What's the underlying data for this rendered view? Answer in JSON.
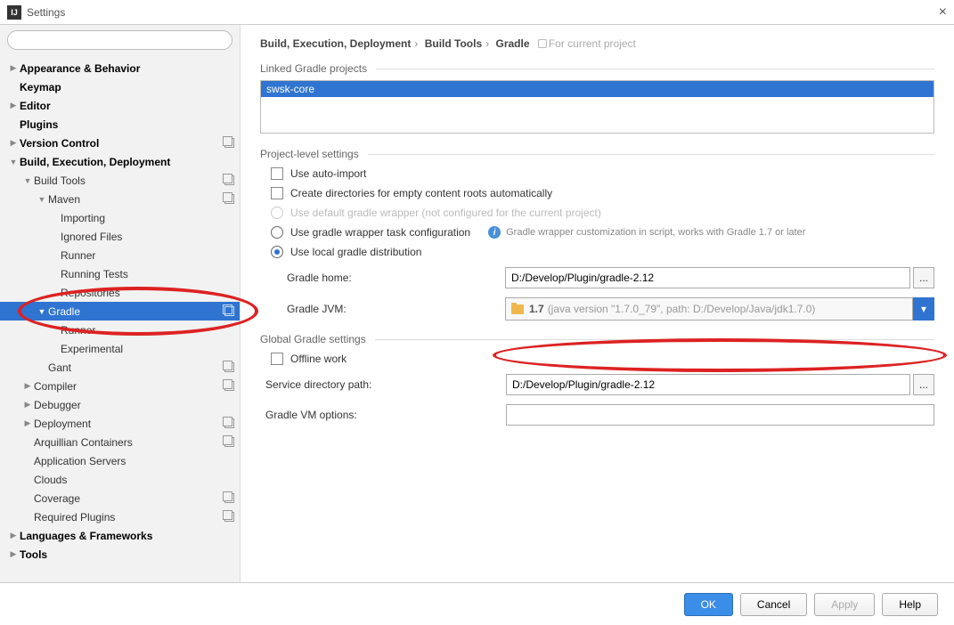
{
  "window": {
    "title": "Settings"
  },
  "breadcrumb": {
    "part1": "Build, Execution, Deployment",
    "part2": "Build Tools",
    "part3": "Gradle",
    "hint": "For current project"
  },
  "tree": {
    "appearance": "Appearance & Behavior",
    "keymap": "Keymap",
    "editor": "Editor",
    "plugins": "Plugins",
    "vcs": "Version Control",
    "bed": "Build, Execution, Deployment",
    "build_tools": "Build Tools",
    "maven": "Maven",
    "importing": "Importing",
    "ignored_files": "Ignored Files",
    "runner1": "Runner",
    "running_tests": "Running Tests",
    "repositories": "Repositories",
    "gradle": "Gradle",
    "runner2": "Runner",
    "experimental": "Experimental",
    "gant": "Gant",
    "compiler": "Compiler",
    "debugger": "Debugger",
    "deployment": "Deployment",
    "arquillian": "Arquillian Containers",
    "app_servers": "Application Servers",
    "clouds": "Clouds",
    "coverage": "Coverage",
    "required_plugins": "Required Plugins",
    "langs": "Languages & Frameworks",
    "tools": "Tools"
  },
  "sections": {
    "linked": "Linked Gradle projects",
    "project": "Project-level settings",
    "global": "Global Gradle settings"
  },
  "listbox": {
    "item": "swsk-core"
  },
  "options": {
    "auto_import": "Use auto-import",
    "create_dirs": "Create directories for empty content roots automatically",
    "use_default": "Use default gradle wrapper (not configured for the current project)",
    "use_wrapper": "Use gradle wrapper task configuration",
    "wrapper_info": "Gradle wrapper customization in script, works with Gradle 1.7 or later",
    "use_local": "Use local gradle distribution",
    "offline": "Offline work"
  },
  "fields": {
    "gradle_home_label": "Gradle home:",
    "gradle_home_value": "D:/Develop/Plugin/gradle-2.12",
    "gradle_jvm_label": "Gradle JVM:",
    "jvm_name": "1.7",
    "jvm_detail": "(java version \"1.7.0_79\", path: D:/Develop/Java/jdk1.7.0)",
    "service_dir_label": "Service directory path:",
    "service_dir_value": "D:/Develop/Plugin/gradle-2.12",
    "vm_options_label": "Gradle VM options:",
    "vm_options_value": ""
  },
  "buttons": {
    "ok": "OK",
    "cancel": "Cancel",
    "apply": "Apply",
    "help": "Help",
    "browse": "..."
  }
}
